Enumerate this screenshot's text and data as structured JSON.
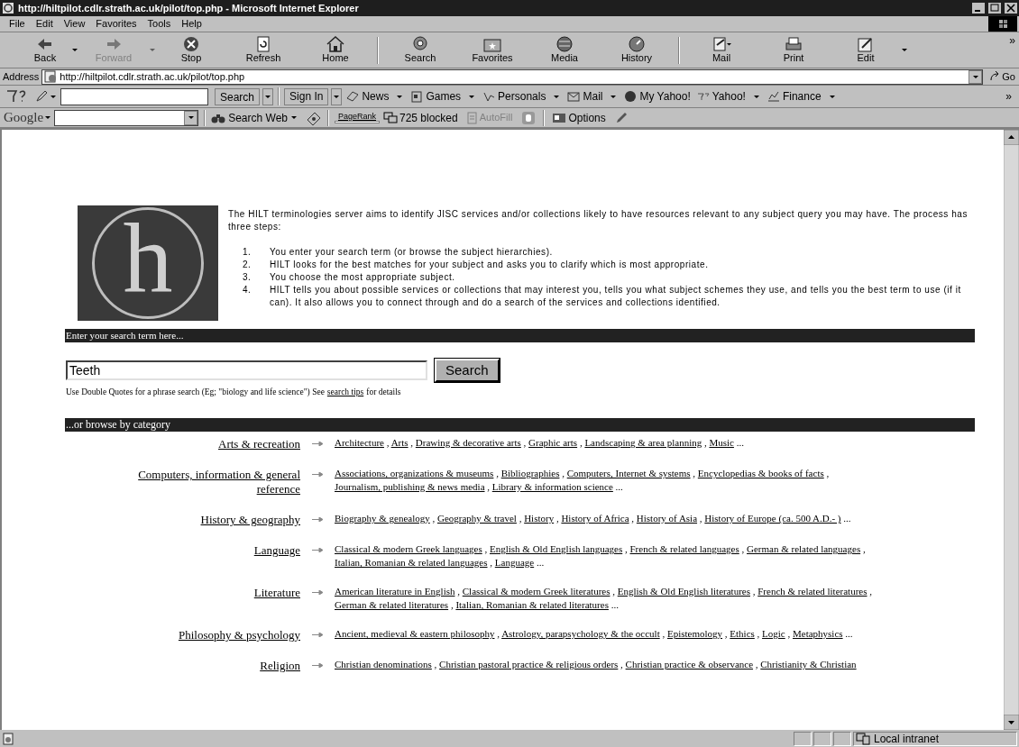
{
  "window": {
    "title": "http://hiltpilot.cdlr.strath.ac.uk/pilot/top.php - Microsoft Internet Explorer"
  },
  "menu": [
    "File",
    "Edit",
    "View",
    "Favorites",
    "Tools",
    "Help"
  ],
  "toolbar": [
    {
      "label": "Back",
      "disabled": false,
      "dropdown": true
    },
    {
      "label": "Forward",
      "disabled": true,
      "dropdown": true
    },
    {
      "label": "Stop",
      "disabled": false,
      "dropdown": false
    },
    {
      "label": "Refresh",
      "disabled": false,
      "dropdown": false
    },
    {
      "label": "Home",
      "disabled": false,
      "dropdown": false
    },
    {
      "label": "Search",
      "disabled": false,
      "dropdown": false
    },
    {
      "label": "Favorites",
      "disabled": false,
      "dropdown": false
    },
    {
      "label": "Media",
      "disabled": false,
      "dropdown": false
    },
    {
      "label": "History",
      "disabled": false,
      "dropdown": false
    },
    {
      "label": "Mail",
      "disabled": false,
      "dropdown": false
    },
    {
      "label": "Print",
      "disabled": false,
      "dropdown": false
    },
    {
      "label": "Edit",
      "disabled": false,
      "dropdown": true
    }
  ],
  "toolbar_more": "»",
  "address": {
    "label": "Address",
    "value": "http://hiltpilot.cdlr.strath.ac.uk/pilot/top.php",
    "go": "Go"
  },
  "yahoo_bar": {
    "search_button": "Search",
    "items": [
      {
        "label": "Sign In",
        "kind": "button",
        "dropdown": true
      },
      {
        "label": "News",
        "kind": "link",
        "dropdown": true
      },
      {
        "label": "Games",
        "kind": "link",
        "dropdown": true
      },
      {
        "label": "Personals",
        "kind": "link",
        "dropdown": true
      },
      {
        "label": "Mail",
        "kind": "link",
        "dropdown": true
      },
      {
        "label": "My Yahoo!",
        "kind": "link",
        "dropdown": false
      },
      {
        "label": "Yahoo!",
        "kind": "link",
        "dropdown": true
      },
      {
        "label": "Finance",
        "kind": "link",
        "dropdown": true
      }
    ],
    "more": "»"
  },
  "google_bar": {
    "logo": "Google",
    "search_web": "Search Web",
    "pagerank": "PageRank",
    "blocked": "725 blocked",
    "autofill": "AutoFill",
    "autofill_disabled": true,
    "options": "Options"
  },
  "page": {
    "logo_letter": "h",
    "intro": "The HILT terminologies server aims to identify JISC services and/or collections likely to have resources relevant to any subject query you may have. The process has three steps:",
    "steps": [
      {
        "number": "1.",
        "text": "You enter your search term (or browse the subject hierarchies)."
      },
      {
        "number": "2.",
        "text": "HILT looks for the best matches for your subject and asks you to clarify which is most appropriate."
      },
      {
        "number": "3.",
        "text": "You choose the most appropriate subject."
      },
      {
        "number": "4.",
        "text": "HILT tells you about possible services or collections that may interest you, tells you what subject schemes they use, and tells you the best term to use (if it can). It also allows you to connect through and do a search of the services and collections identified."
      }
    ],
    "search_heading": "Enter your search term here...",
    "search_value": "Teeth",
    "search_button": "Search",
    "hint": "Use Double Quotes for a phrase search (Eg; \"biology and life science\") See",
    "hint_link": "search tips",
    "hint_end": "for details",
    "browse_heading": "...or browse by category",
    "separator": ",",
    "categories": [
      {
        "name": "Arts & recreation",
        "links": [
          "Architecture",
          "Arts",
          "Drawing & decorative arts",
          "Graphic arts",
          "Landscaping & area planning",
          "Music"
        ],
        "more": "..."
      },
      {
        "name": "Computers, information & general reference",
        "links": [
          "Associations, organizations & museums",
          "Bibliographies",
          "Computers, Internet & systems",
          "Encyclopedias & books of facts",
          "Journalism, publishing & news media",
          "Library & information science"
        ],
        "more": "..."
      },
      {
        "name": "History & geography",
        "links": [
          "Biography & genealogy",
          "Geography & travel",
          "History",
          "History of Africa",
          "History of Asia",
          "History of Europe (ca. 500 A.D.- )"
        ],
        "more": "..."
      },
      {
        "name": "Language",
        "links": [
          "Classical & modern Greek languages",
          "English & Old English languages",
          "French & related languages",
          "German & related languages",
          "Italian, Romanian & related languages",
          "Language"
        ],
        "more": "..."
      },
      {
        "name": "Literature",
        "links": [
          "American literature in English",
          "Classical & modern Greek literatures",
          "English & Old English literatures",
          "French & related literatures",
          "German & related literatures",
          "Italian, Romanian & related literatures"
        ],
        "more": "..."
      },
      {
        "name": "Philosophy & psychology",
        "links": [
          "Ancient, medieval & eastern philosophy",
          "Astrology, parapsychology & the occult",
          "Epistemology",
          "Ethics",
          "Logic",
          "Metaphysics"
        ],
        "more": "..."
      },
      {
        "name": "Religion",
        "links": [
          "Christian denominations",
          "Christian pastoral practice & religious orders",
          "Christian practice & observance",
          "Christianity & Christian"
        ]
      }
    ]
  },
  "status_bar": {
    "zone": "Local intranet"
  }
}
